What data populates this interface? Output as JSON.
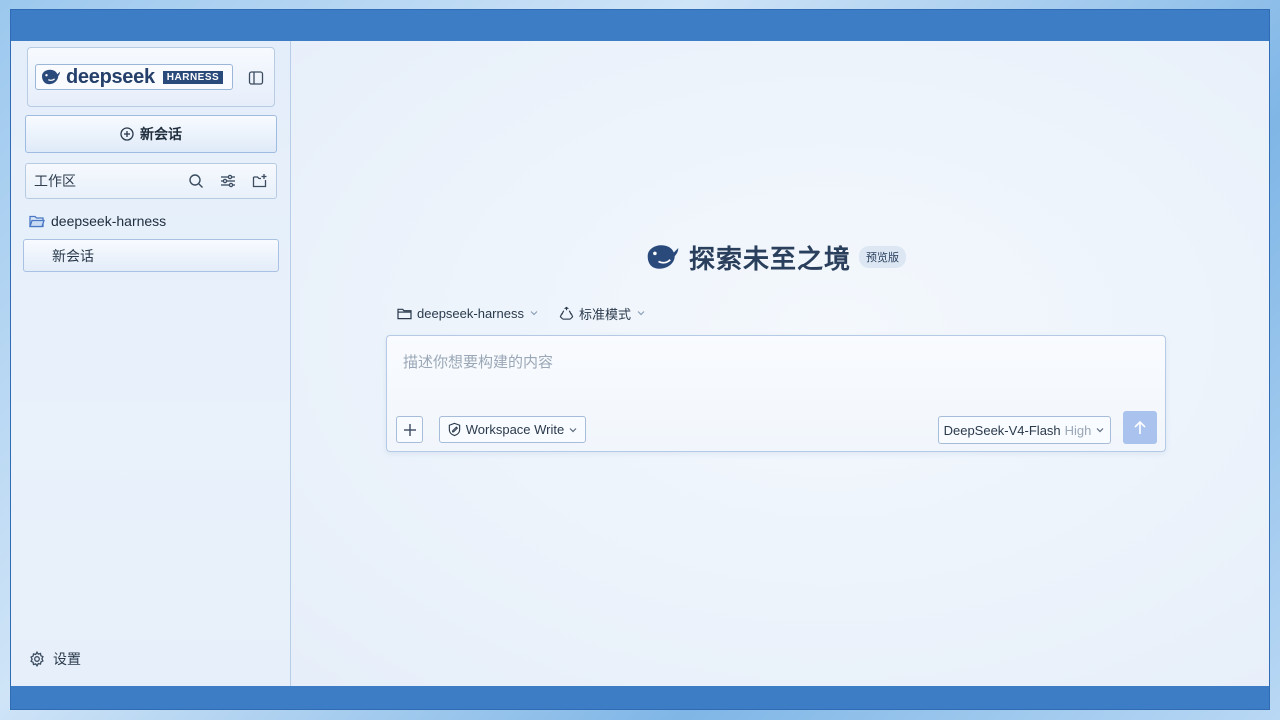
{
  "sidebar": {
    "brand": {
      "name": "deepseek",
      "badge": "HARNESS",
      "logo_icon": "whale-icon"
    },
    "new_chat_label": "新会话",
    "workspace": {
      "label": "工作区",
      "actions": [
        "search-icon",
        "filter-sliders-icon",
        "new-folder-icon"
      ]
    },
    "project": {
      "name": "deepseek-harness"
    },
    "sessions": [
      {
        "label": "新会话"
      }
    ],
    "settings_label": "设置"
  },
  "main": {
    "hero": {
      "title": "探索未至之境",
      "badge": "预览版"
    },
    "context": {
      "project": "deepseek-harness",
      "mode": "标准模式"
    },
    "composer": {
      "placeholder": "描述你想要构建的内容",
      "value": "",
      "permission": "Workspace Write",
      "model": "DeepSeek-V4-Flash",
      "model_level": "High"
    }
  },
  "colors": {
    "frame": "#3d7dc6",
    "brand_dark": "#25406a",
    "send_button": "#a9c3ee"
  }
}
